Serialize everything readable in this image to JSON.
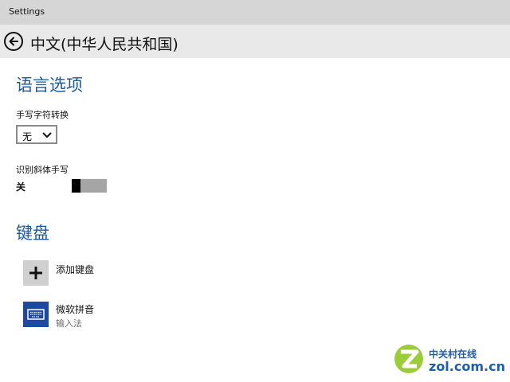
{
  "window": {
    "title": "Settings"
  },
  "header": {
    "title": "中文(中华人民共和国)",
    "back_icon": "back-arrow-icon"
  },
  "language_options": {
    "heading": "语言选项",
    "handwriting_conversion": {
      "label": "手写字符转换",
      "selected": "无"
    },
    "italic_handwriting": {
      "label": "识别斜体手写",
      "state_label": "关",
      "on": false
    }
  },
  "keyboards": {
    "heading": "键盘",
    "add": {
      "label": "添加键盘",
      "icon": "plus-icon"
    },
    "items": [
      {
        "name": "微软拼音",
        "sub": "输入法",
        "icon": "keyboard-icon",
        "tile_color": "#1b4aa0"
      }
    ]
  },
  "watermark": {
    "cn": "中关村在线",
    "en": "zol.com.cn"
  },
  "colors": {
    "accent": "#1e5a9a",
    "tile_blue": "#1b4aa0",
    "header_bg": "#e9e9e9",
    "titlebar_bg": "#d6d6d6"
  }
}
